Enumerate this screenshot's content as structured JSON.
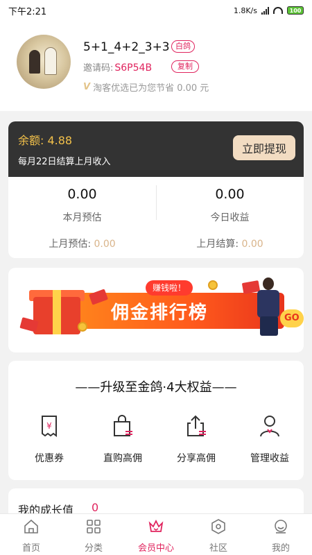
{
  "status_bar": {
    "time": "下午2:21",
    "speed": "1.8K/s",
    "battery": "100"
  },
  "profile": {
    "username": "5+1_4+2_3+3",
    "level_tag": "白鸽",
    "invite_label": "邀请码:",
    "invite_code": "S6P54B",
    "copy_label": "复制",
    "saved_text": "淘客优选已为您节省 0.00 元"
  },
  "balance": {
    "amount_label": "余额: 4.88",
    "note": "每月22日结算上月收入",
    "withdraw_label": "立即提现",
    "stats": [
      {
        "value": "0.00",
        "label": "本月预估",
        "sub_label": "上月预估:",
        "sub_value": "0.00"
      },
      {
        "value": "0.00",
        "label": "今日收益",
        "sub_label": "上月结算:",
        "sub_value": "0.00"
      }
    ]
  },
  "banner": {
    "tag": "赚钱啦！",
    "title": "佣金排行榜",
    "go": "GO"
  },
  "benefits": {
    "title": "——升级至金鸽·4大权益——",
    "items": [
      {
        "label": "优惠券",
        "icon": "coupon-icon"
      },
      {
        "label": "直购高佣",
        "icon": "shopping-bag-icon"
      },
      {
        "label": "分享高佣",
        "icon": "share-icon"
      },
      {
        "label": "管理收益",
        "icon": "user-manage-icon"
      }
    ]
  },
  "growth": {
    "label": "我的成长值",
    "value": "0"
  },
  "tabs": [
    {
      "label": "首页",
      "icon": "home-icon"
    },
    {
      "label": "分类",
      "icon": "category-icon"
    },
    {
      "label": "会员中心",
      "icon": "crown-icon",
      "active": true
    },
    {
      "label": "社区",
      "icon": "community-icon"
    },
    {
      "label": "我的",
      "icon": "profile-icon"
    }
  ],
  "colors": {
    "accent": "#e0245e",
    "gold": "#f3c14a",
    "dark_card": "#333333",
    "withdraw_bg": "#f2dcc2"
  }
}
